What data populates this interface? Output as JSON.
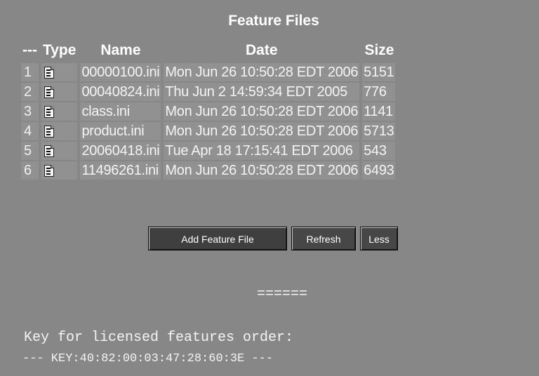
{
  "panel": {
    "title": "Feature Files"
  },
  "table": {
    "headers": {
      "num": "---",
      "type": "Type",
      "name": "Name",
      "date": "Date",
      "size": "Size"
    },
    "rows": [
      {
        "num": "1",
        "icon": "file-icon",
        "name": "00000100.ini",
        "date": "Mon Jun 26 10:50:28 EDT 2006",
        "size": "5151"
      },
      {
        "num": "2",
        "icon": "file-icon",
        "name": "00040824.ini",
        "date": "Thu Jun 2 14:59:34 EDT 2005",
        "size": "776"
      },
      {
        "num": "3",
        "icon": "file-icon",
        "name": "class.ini",
        "date": "Mon Jun 26 10:50:28 EDT 2006",
        "size": "1141"
      },
      {
        "num": "4",
        "icon": "file-icon",
        "name": "product.ini",
        "date": "Mon Jun 26 10:50:28 EDT 2006",
        "size": "5713"
      },
      {
        "num": "5",
        "icon": "file-icon",
        "name": "20060418.ini",
        "date": "Tue Apr 18 17:15:41 EDT 2006",
        "size": "543"
      },
      {
        "num": "6",
        "icon": "file-icon",
        "name": "11496261.ini",
        "date": "Mon Jun 26 10:50:28 EDT 2006",
        "size": "6493"
      }
    ]
  },
  "buttons": {
    "add_label": "Add Feature File",
    "refresh_label": "Refresh",
    "less_label": "Less"
  },
  "separator": "======",
  "key": {
    "title": "Key for licensed features order:",
    "value": "--- KEY:40:82:00:03:47:28:60:3E ---"
  },
  "colors": {
    "background": "#878787",
    "row_background": "#919191",
    "text": "#ffffff"
  }
}
